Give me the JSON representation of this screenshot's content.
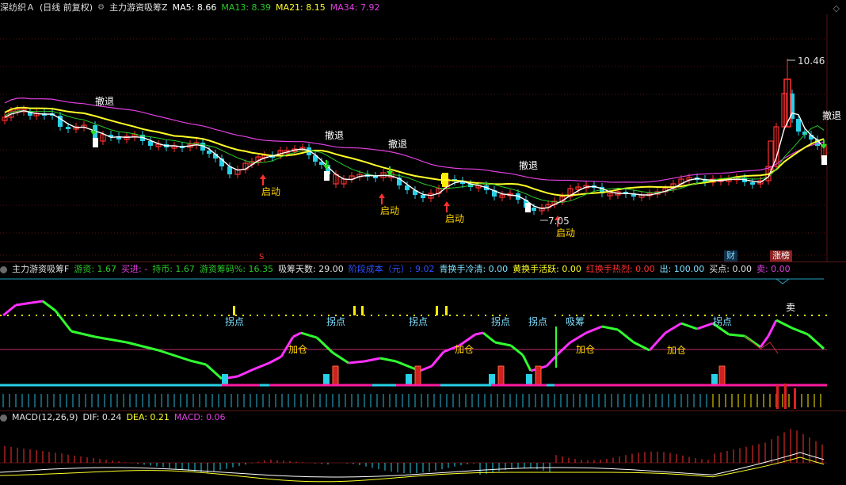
{
  "main_header": {
    "stock": "深纺织Ａ",
    "period": "(日线 前复权)",
    "indicator": "主力游资吸筹Z",
    "ma5": "MA5: 8.66",
    "ma13": "MA13: 8.39",
    "ma21": "MA21: 8.15",
    "ma34": "MA34: 7.92"
  },
  "mid_header": {
    "indicator": "主力游资吸筹F",
    "youzi": "游资: 1.67",
    "maijin": "买进: -",
    "chibi": "持币: 1.67",
    "chouma": "游资筹码%: 16.35",
    "tianshu": "吸筹天数: 29.00",
    "chengben": "阶段成本（元）: 9.02",
    "qinghuan": "青换手冷清: 0.00",
    "huanghuan": "黄换手活跃: 0.00",
    "honghuan": "红换手热烈: 0.00",
    "chu": "出: 100.00",
    "maidian": "买点: 0.00",
    "mai": "卖: 0.00"
  },
  "macd_header": {
    "name": "MACD(12,26,9)",
    "dif": "DIF: 0.24",
    "dea": "DEA: 0.21",
    "macd": "MACD: 0.06"
  },
  "annotations": {
    "high_price": "10.46",
    "low_price": "7.05",
    "chetui": "撤退",
    "qidong": "启动",
    "guaidian": "拐点",
    "jiacang": "加仓",
    "xichou": "吸筹",
    "sell": "卖",
    "cai": "财",
    "zhangbang": "涨榜",
    "s_marker": "S"
  },
  "colors": {
    "up": "#ff3030",
    "down": "#28d0e8",
    "ma5": "#ffffff",
    "ma13": "#28c828",
    "ma21": "#ffff28",
    "ma34": "#e040e0",
    "label_yellow": "#ffd400"
  },
  "icons": {
    "settings": "gear-icon",
    "corner": "diamond-icon"
  }
}
